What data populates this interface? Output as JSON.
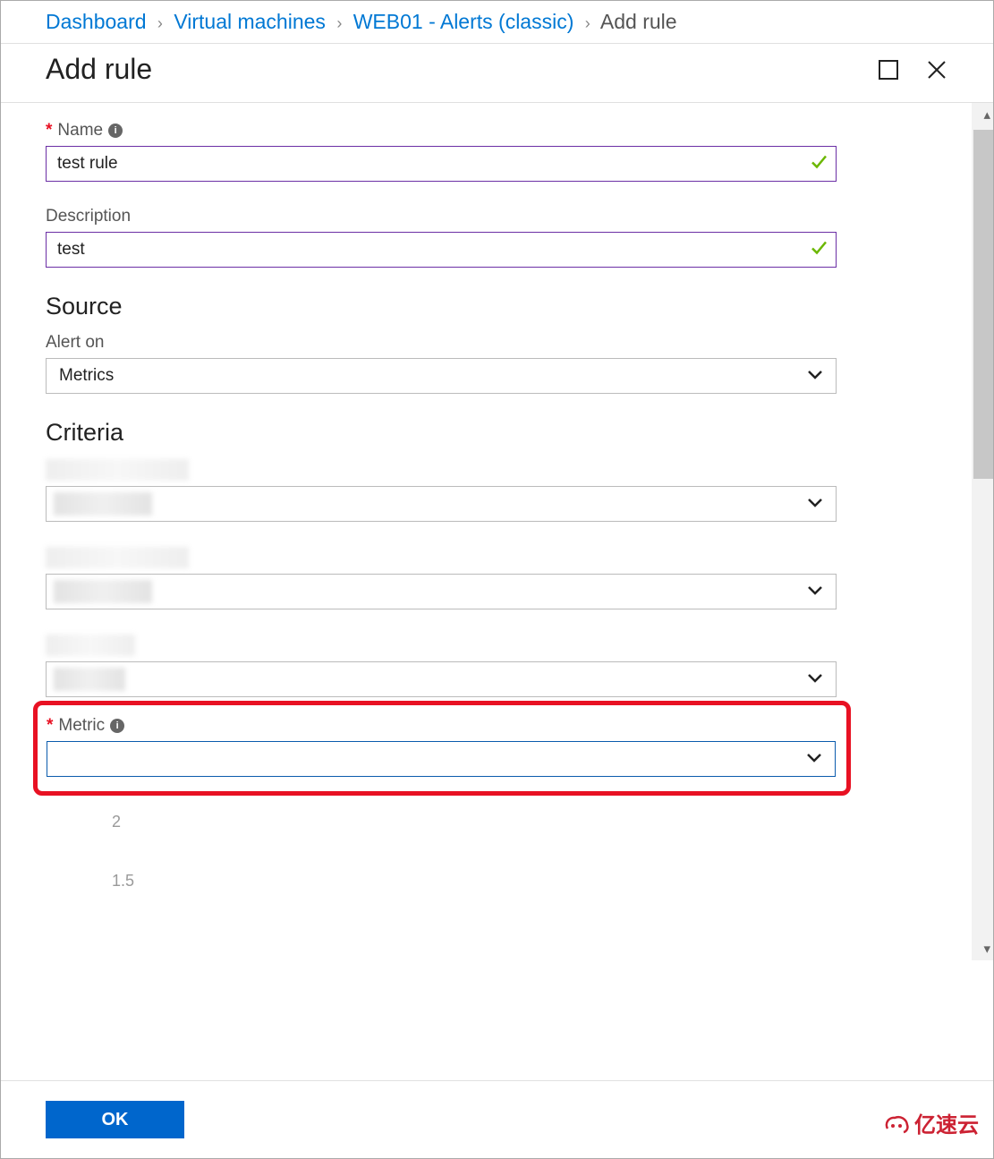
{
  "breadcrumb": {
    "items": [
      {
        "label": "Dashboard",
        "link": true
      },
      {
        "label": "Virtual machines",
        "link": true
      },
      {
        "label": "WEB01 - Alerts (classic)",
        "link": true
      },
      {
        "label": "Add rule",
        "link": false
      }
    ]
  },
  "header": {
    "title": "Add rule"
  },
  "form": {
    "name": {
      "label": "Name",
      "required": true,
      "value": "test rule",
      "valid": true
    },
    "desc": {
      "label": "Description",
      "required": false,
      "value": "test",
      "valid": true
    },
    "source_heading": "Source",
    "alert_on": {
      "label": "Alert on",
      "selected": "Metrics"
    },
    "criteria_heading": "Criteria",
    "criteria_selects": [
      {
        "label_hidden": true,
        "value_hidden": true
      },
      {
        "label_hidden": true,
        "value_hidden": true
      },
      {
        "label_hidden": true,
        "value_hidden": true
      }
    ],
    "metric": {
      "label": "Metric",
      "required": true,
      "selected": ""
    },
    "y_ticks": [
      "2",
      "1.5"
    ]
  },
  "footer": {
    "ok": "OK"
  },
  "watermark": "亿速云"
}
